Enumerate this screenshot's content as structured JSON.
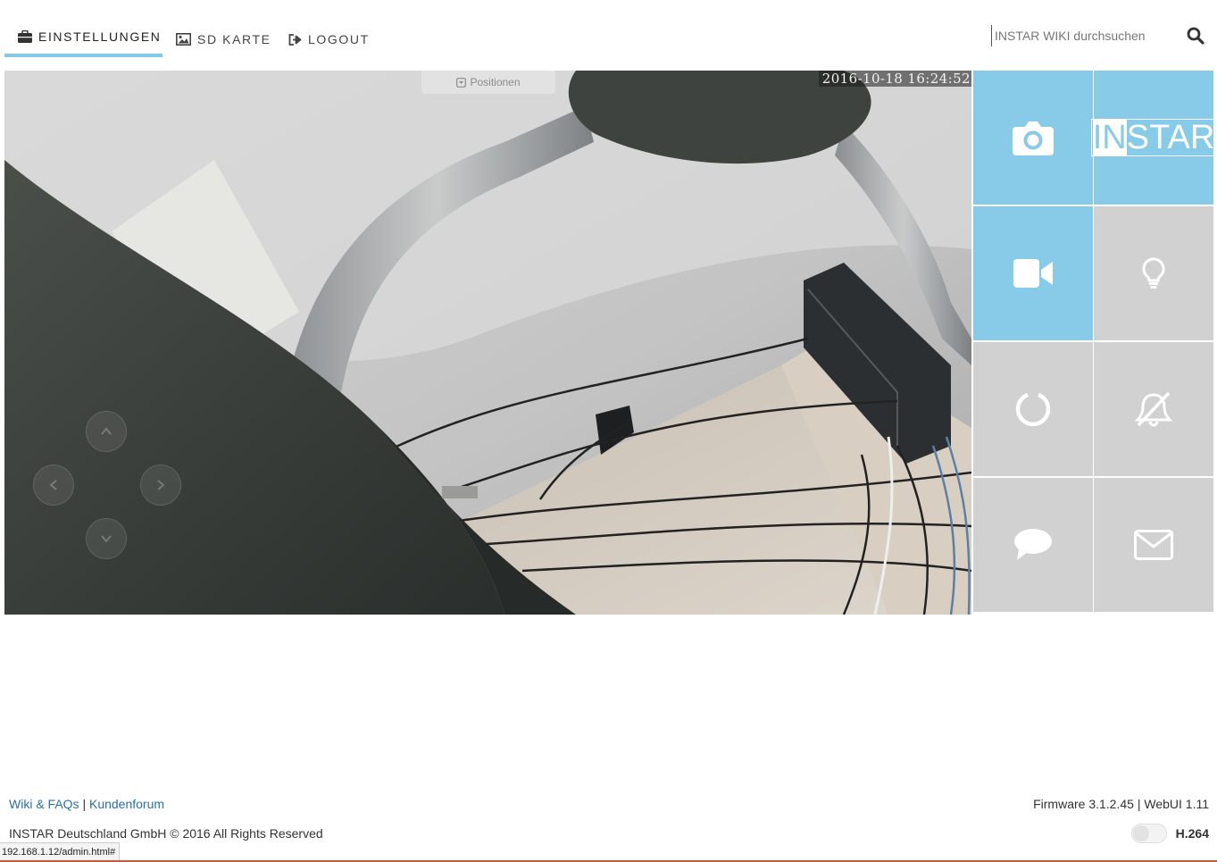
{
  "nav": {
    "settings_label": "EINSTELLUNGEN",
    "sdcard_label": "SD KARTE",
    "logout_label": "LOGOUT"
  },
  "search": {
    "placeholder": "INSTAR WIKI durchsuchen"
  },
  "video": {
    "timestamp": "2016-10-18 16:24:52",
    "positions_label": "Positionen"
  },
  "tiles": {
    "brand_highlight": "IN",
    "brand_rest": "STAR",
    "items": [
      {
        "icon": "camera-icon",
        "color": "#87cbe9"
      },
      {
        "icon": "instar-logo",
        "color": "#87cbe9"
      },
      {
        "icon": "video-camera-icon",
        "color": "#87cbe9"
      },
      {
        "icon": "lightbulb-icon",
        "color": "#d1d1d1"
      },
      {
        "icon": "reset-circle-icon",
        "color": "#d1d1d1"
      },
      {
        "icon": "bell-slash-icon",
        "color": "#d1d1d1"
      },
      {
        "icon": "speech-bubble-icon",
        "color": "#d1d1d1"
      },
      {
        "icon": "envelope-icon",
        "color": "#d1d1d1"
      }
    ]
  },
  "footer": {
    "wiki_link": "Wiki & FAQs",
    "separator": "|",
    "forum_link": "Kundenforum",
    "copyright": "INSTAR Deutschland GmbH © 2016 All Rights Reserved",
    "firmware": "Firmware 3.1.2.45",
    "webui": "WebUI 1.11",
    "codec_label": "H.264"
  },
  "statusbar": {
    "url": "192.168.1.12/admin.html#"
  },
  "colors": {
    "accent": "#85c9e8",
    "tile_blue": "#87cbe9",
    "tile_grey": "#d1d1d1",
    "link": "#2a6fad"
  }
}
